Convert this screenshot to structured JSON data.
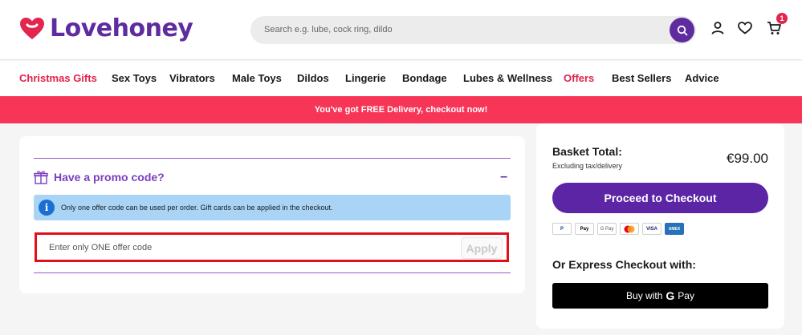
{
  "header": {
    "logo_text": "Lovehoney",
    "search_placeholder": "Search e.g. lube, cock ring, dildo",
    "cart_count": "1"
  },
  "nav": {
    "items": [
      {
        "label": "Christmas Gifts",
        "highlight": true
      },
      {
        "label": "Sex Toys",
        "highlight": false
      },
      {
        "label": "Vibrators",
        "highlight": false
      },
      {
        "label": "Male Toys",
        "highlight": false
      },
      {
        "label": "Dildos",
        "highlight": false
      },
      {
        "label": "Lingerie",
        "highlight": false
      },
      {
        "label": "Bondage",
        "highlight": false
      },
      {
        "label": "Lubes & Wellness",
        "highlight": false
      },
      {
        "label": "Offers",
        "highlight": true
      },
      {
        "label": "Best Sellers",
        "highlight": false
      },
      {
        "label": "Advice",
        "highlight": false
      }
    ]
  },
  "banner": {
    "text": "You've got FREE Delivery, checkout now!"
  },
  "promo": {
    "title": "Have a promo code?",
    "toggle_symbol": "–",
    "info_icon": "i",
    "info_text": "Only one offer code can be used per order. Gift cards can be applied in the checkout.",
    "input_placeholder": "Enter only ONE offer code",
    "apply_label": "Apply"
  },
  "summary": {
    "title": "Basket Total:",
    "subtitle": "Excluding tax/delivery",
    "total": "€99.00",
    "checkout_label": "Proceed to Checkout",
    "payment_methods": [
      "P",
      "Pay",
      "G Pay",
      "",
      "VISA",
      "AMEX"
    ],
    "express_title": "Or Express Checkout with:",
    "gpay_prefix": "Buy with",
    "gpay_g": "G",
    "gpay_suffix": "Pay"
  },
  "colors": {
    "brand_purple": "#5f2ca0",
    "accent_red": "#f73557",
    "info_blue": "#aad4f5"
  }
}
